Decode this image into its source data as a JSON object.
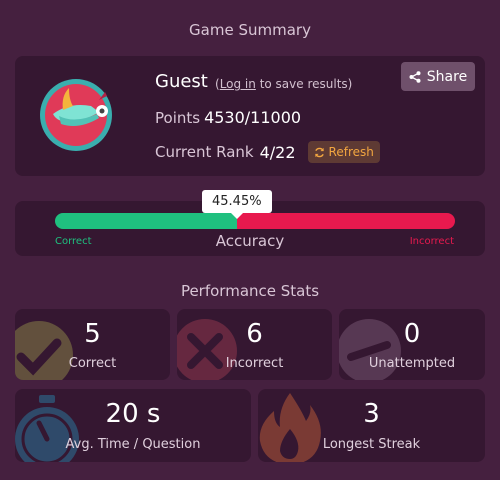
{
  "summary": {
    "title": "Game Summary",
    "player_name": "Guest",
    "login_prefix": "(",
    "login_link": "Log in",
    "login_suffix": " to save results)",
    "share_label": "Share",
    "points_label": "Points",
    "points_value": "4530/11000",
    "rank_label": "Current Rank",
    "rank_value": "4/22",
    "refresh_label": "Refresh"
  },
  "accuracy": {
    "percent_text": "45.45%",
    "fraction": 0.4545,
    "title": "Accuracy",
    "correct_label": "Correct",
    "incorrect_label": "Incorrect",
    "correct_color": "#1fc07f",
    "incorrect_color": "#e8194e"
  },
  "performance": {
    "title": "Performance Stats",
    "stats": [
      {
        "value": "5",
        "label": "Correct",
        "icon": "check-icon"
      },
      {
        "value": "6",
        "label": "Incorrect",
        "icon": "cross-icon"
      },
      {
        "value": "0",
        "label": "Unattempted",
        "icon": "minus-icon"
      },
      {
        "value": "20 s",
        "label": "Avg. Time / Question",
        "icon": "stopwatch-icon"
      },
      {
        "value": "3",
        "label": "Longest Streak",
        "icon": "flame-icon"
      }
    ]
  },
  "colors": {
    "background": "#45203f",
    "card": "#351731",
    "share_button": "#6f506b",
    "refresh_text": "#f2a640"
  }
}
